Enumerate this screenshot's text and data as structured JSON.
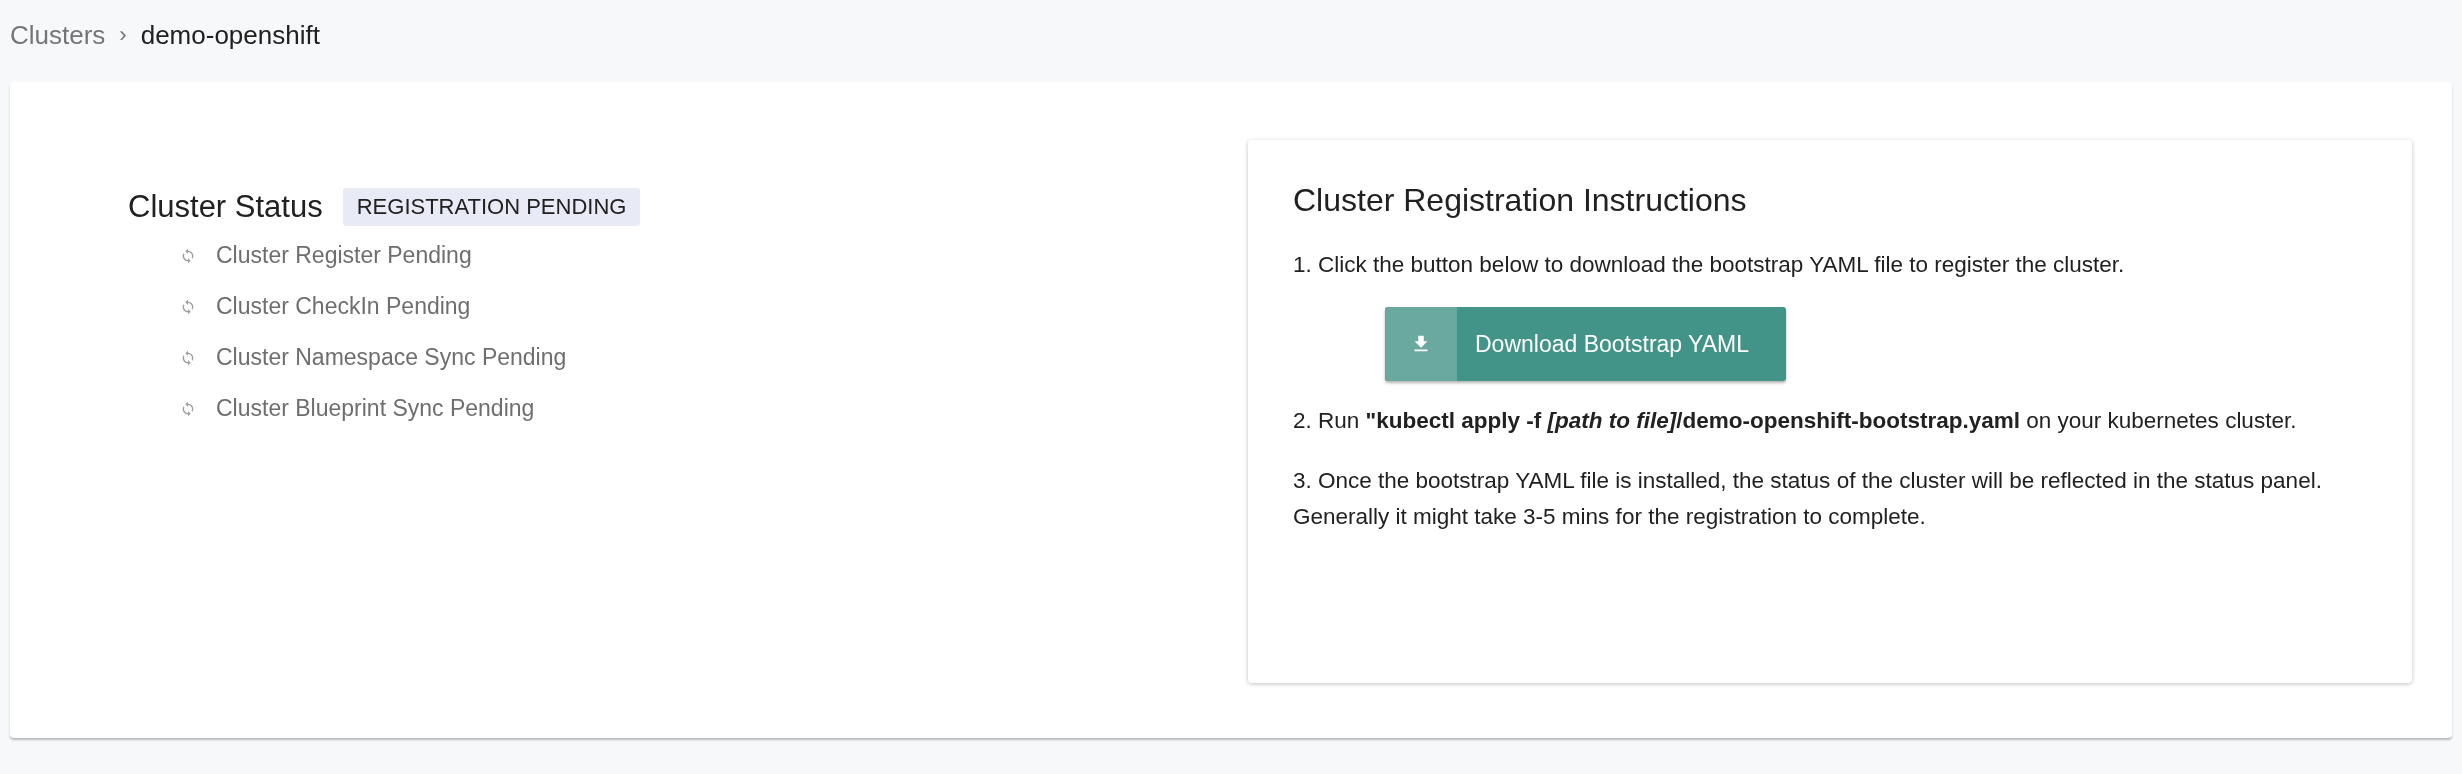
{
  "breadcrumb": {
    "parent": "Clusters",
    "separator": "›",
    "current": "demo-openshift"
  },
  "status": {
    "title": "Cluster Status",
    "badge": "REGISTRATION PENDING",
    "items": [
      {
        "label": "Cluster Register Pending"
      },
      {
        "label": "Cluster CheckIn Pending"
      },
      {
        "label": "Cluster Namespace Sync Pending"
      },
      {
        "label": "Cluster Blueprint Sync Pending"
      }
    ]
  },
  "instructions": {
    "title": "Cluster Registration Instructions",
    "step_1": "1. Click the button below to download the bootstrap YAML file to register the cluster.",
    "button": "Download Bootstrap YAML",
    "step_2": "2. Run  **\"kubectl apply -f  *[path to file]*/demo-openshift-bootstrap.yaml**  on your kubernetes cluster.",
    "step_3": "3. Once the bootstrap YAML file is installed, the status of the cluster will be reflected in the status panel. Generally it might take 3-5 mins for the registration to complete."
  }
}
